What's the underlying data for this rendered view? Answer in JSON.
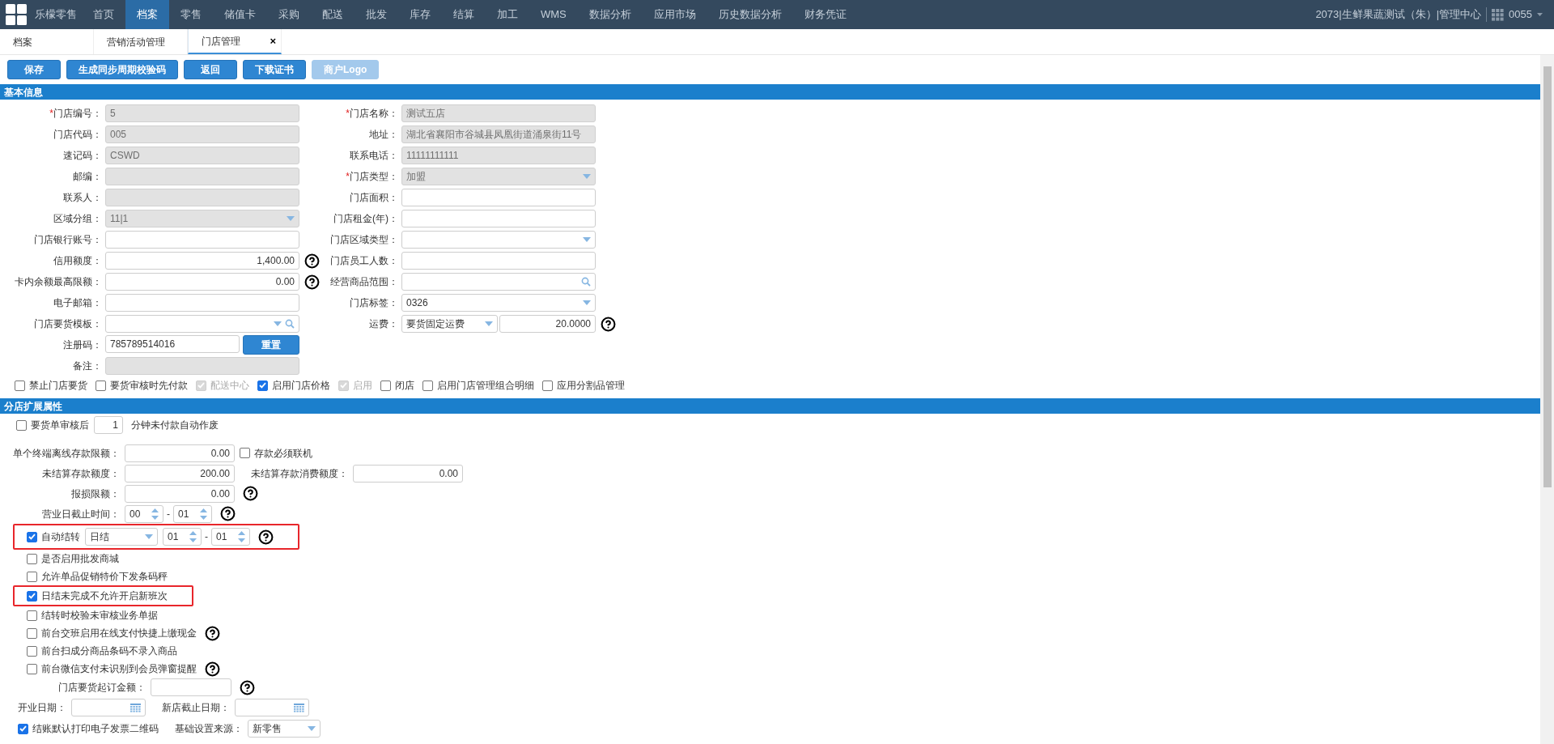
{
  "nav": {
    "brand": "乐檬零售",
    "items": [
      {
        "label": "首页",
        "selected": false
      },
      {
        "label": "档案",
        "selected": true
      },
      {
        "label": "零售",
        "selected": false
      },
      {
        "label": "储值卡",
        "selected": false
      },
      {
        "label": "采购",
        "selected": false
      },
      {
        "label": "配送",
        "selected": false
      },
      {
        "label": "批发",
        "selected": false
      },
      {
        "label": "库存",
        "selected": false
      },
      {
        "label": "结算",
        "selected": false
      },
      {
        "label": "加工",
        "selected": false
      },
      {
        "label": "WMS",
        "selected": false
      },
      {
        "label": "数据分析",
        "selected": false
      },
      {
        "label": "应用市场",
        "selected": false
      },
      {
        "label": "历史数据分析",
        "selected": false
      },
      {
        "label": "财务凭证",
        "selected": false
      }
    ],
    "account": "2073|生鲜果蔬测试（朱）|管理中心",
    "user": "0055"
  },
  "tabs": [
    {
      "label": "档案",
      "selected": false
    },
    {
      "label": "营销活动管理",
      "selected": false
    },
    {
      "label": "门店管理",
      "selected": true,
      "close": "×"
    }
  ],
  "toolbar": [
    {
      "label": "保存",
      "disabled": false
    },
    {
      "label": "生成同步周期校验码",
      "disabled": false
    },
    {
      "label": "返回",
      "disabled": false
    },
    {
      "label": "下载证书",
      "disabled": false
    },
    {
      "label": "商户Logo",
      "disabled": true
    }
  ],
  "basic": {
    "title": "基本信息",
    "rows": [
      {
        "left": {
          "marker": "*",
          "label": "门店编号：",
          "kind": "input",
          "value": "5",
          "disabled": true,
          "numeric": false,
          "help": false
        },
        "right": {
          "marker": "*",
          "label": "门店名称：",
          "kind": "input",
          "value": "测试五店",
          "disabled": true,
          "numeric": false,
          "help": false
        }
      },
      {
        "left": {
          "label": "门店代码：",
          "kind": "input",
          "value": "005",
          "disabled": true,
          "numeric": false,
          "help": false
        },
        "right": {
          "label": "地址：",
          "kind": "input",
          "value": "湖北省襄阳市谷城县凤凰街道涌泉街11号",
          "disabled": true,
          "numeric": false,
          "help": false
        }
      },
      {
        "left": {
          "label": "速记码：",
          "kind": "input",
          "value": "CSWD",
          "disabled": true,
          "numeric": false,
          "help": false
        },
        "right": {
          "label": "联系电话：",
          "kind": "input",
          "value": "11111111111",
          "disabled": true,
          "numeric": false,
          "help": false
        }
      },
      {
        "left": {
          "label": "邮编：",
          "kind": "input",
          "disabled": true,
          "help": false
        },
        "right": {
          "marker": "*",
          "label": "门店类型：",
          "kind": "select",
          "value": "加盟",
          "disabled": true,
          "help": false
        }
      },
      {
        "left": {
          "label": "联系人：",
          "kind": "input",
          "disabled": true,
          "help": false
        },
        "right": {
          "label": "门店面积：",
          "kind": "input",
          "disabled": false,
          "help": false
        }
      },
      {
        "left": {
          "label": "区域分组：",
          "kind": "select",
          "value": "11|1",
          "disabled": true,
          "help": false
        },
        "right": {
          "label": "门店租金(年)：",
          "kind": "input",
          "disabled": false,
          "help": false
        }
      },
      {
        "left": {
          "label": "门店银行账号：",
          "kind": "input",
          "disabled": false,
          "help": false
        },
        "right": {
          "label": "门店区域类型：",
          "kind": "select",
          "disabled": false,
          "help": false
        }
      },
      {
        "left": {
          "label": "信用额度：",
          "kind": "input",
          "value": "1,400.00",
          "disabled": false,
          "numeric": true,
          "help": true
        },
        "right": {
          "label": "门店员工人数：",
          "kind": "input",
          "disabled": false,
          "help": false
        }
      },
      {
        "left": {
          "label": "卡内余额最高限额：",
          "kind": "input",
          "value": "0.00",
          "disabled": false,
          "numeric": true,
          "help": true
        },
        "right": {
          "label": "经营商品范围：",
          "kind": "search",
          "disabled": false,
          "help": false
        }
      },
      {
        "left": {
          "label": "电子邮箱：",
          "kind": "input",
          "disabled": false,
          "help": false
        },
        "right": {
          "label": "门店标签：",
          "kind": "select",
          "value": "0326",
          "disabled": false,
          "help": false
        }
      },
      {
        "left": {
          "label": "门店要货模板：",
          "kind": "select_search",
          "disabled": false,
          "help": false
        },
        "right": {
          "label": "运费：",
          "kind": "select_input",
          "value": "要货固定运费",
          "value2": "20.0000",
          "disabled": false,
          "help": true
        }
      },
      {
        "left": {
          "label": "注册码：",
          "kind": "input_button",
          "value": "785789514016",
          "button": "重置",
          "disabled": false,
          "help": false
        }
      },
      {
        "left": {
          "label": "备注：",
          "kind": "input",
          "disabled": true,
          "help": false
        }
      }
    ],
    "checkboxes": [
      {
        "label": "禁止门店要货",
        "checked": false,
        "disabled": false
      },
      {
        "label": "要货审核时先付款",
        "checked": false,
        "disabled": false
      },
      {
        "label": "配送中心",
        "checked": true,
        "disabled": true
      },
      {
        "label": "启用门店价格",
        "checked": true,
        "disabled": false
      },
      {
        "label": "启用",
        "checked": true,
        "disabled": true
      },
      {
        "label": "闭店",
        "checked": false,
        "disabled": false
      },
      {
        "label": "启用门店管理组合明细",
        "checked": false,
        "disabled": false
      },
      {
        "label": "应用分割品管理",
        "checked": false,
        "disabled": false
      }
    ]
  },
  "extended": {
    "title": "分店扩展属性",
    "rows": [
      {
        "kind": "inline",
        "highlighted": false,
        "items": [
          {
            "kind": "checkbox",
            "label": "要货单审核后",
            "checked": false
          },
          {
            "kind": "count",
            "value": "1"
          },
          {
            "kind": "text",
            "text": "分钟未付款自动作废"
          }
        ]
      },
      {
        "kind": "form",
        "highlighted": false,
        "items": [
          {
            "kind": "label",
            "text": "单个终端离线存款限额："
          },
          {
            "kind": "input",
            "value": "0.00"
          },
          {
            "kind": "checkbox",
            "label": "存款必须联机",
            "checked": false
          }
        ]
      },
      {
        "kind": "form",
        "highlighted": false,
        "items": [
          {
            "kind": "label",
            "text": "未结算存款额度："
          },
          {
            "kind": "input",
            "value": "200.00"
          },
          {
            "kind": "label",
            "text": "未结算存款消费额度："
          },
          {
            "kind": "input",
            "value": "0.00"
          }
        ]
      },
      {
        "kind": "form",
        "highlighted": false,
        "items": [
          {
            "kind": "label",
            "text": "报损限额："
          },
          {
            "kind": "input",
            "value": "0.00"
          },
          {
            "kind": "help"
          }
        ]
      },
      {
        "kind": "form",
        "highlighted": false,
        "items": [
          {
            "kind": "label",
            "text": "营业日截止时间："
          },
          {
            "kind": "spinner",
            "value": "00"
          },
          {
            "kind": "dash",
            "text": "-"
          },
          {
            "kind": "spinner",
            "value": "01"
          },
          {
            "kind": "help"
          }
        ]
      },
      {
        "kind": "check",
        "highlighted": true,
        "items": [
          {
            "kind": "checkbox",
            "label": "自动结转",
            "checked": true
          },
          {
            "kind": "select",
            "value": "日结"
          },
          {
            "kind": "spinner",
            "value": "01"
          },
          {
            "kind": "dash",
            "text": "-"
          },
          {
            "kind": "spinner",
            "value": "01"
          },
          {
            "kind": "help"
          }
        ]
      },
      {
        "kind": "check",
        "highlighted": false,
        "items": [
          {
            "kind": "checkbox",
            "label": "是否启用批发商城",
            "checked": false
          }
        ]
      },
      {
        "kind": "check",
        "highlighted": false,
        "items": [
          {
            "kind": "checkbox",
            "label": "允许单品促销特价下发条码秤",
            "checked": false
          }
        ]
      },
      {
        "kind": "check",
        "highlighted": true,
        "items": [
          {
            "kind": "checkbox",
            "label": "日结未完成不允许开启新班次",
            "checked": true
          }
        ]
      },
      {
        "kind": "check",
        "highlighted": false,
        "items": [
          {
            "kind": "checkbox",
            "label": "结转时校验未审核业务单据",
            "checked": false
          }
        ]
      },
      {
        "kind": "check",
        "highlighted": false,
        "items": [
          {
            "kind": "checkbox",
            "label": "前台交班启用在线支付快捷上缴现金",
            "checked": false
          },
          {
            "kind": "help"
          }
        ]
      },
      {
        "kind": "check",
        "highlighted": false,
        "items": [
          {
            "kind": "checkbox",
            "label": "前台扫成分商品条码不录入商品",
            "checked": false
          }
        ]
      },
      {
        "kind": "check",
        "highlighted": false,
        "items": [
          {
            "kind": "checkbox",
            "label": "前台微信支付未识别到会员弹窗提醒",
            "checked": false
          },
          {
            "kind": "help"
          }
        ]
      },
      {
        "kind": "wide",
        "highlighted": false,
        "items": [
          {
            "kind": "label",
            "text": "门店要货起订金额："
          },
          {
            "kind": "amount"
          },
          {
            "kind": "help"
          }
        ]
      },
      {
        "kind": "dates",
        "highlighted": false,
        "items": [
          {
            "kind": "label",
            "text": "开业日期："
          },
          {
            "kind": "date"
          },
          {
            "kind": "label",
            "text": "新店截止日期："
          },
          {
            "kind": "date"
          }
        ]
      },
      {
        "kind": "dates",
        "highlighted": false,
        "items": [
          {
            "kind": "checkbox",
            "label": "结账默认打印电子发票二维码",
            "checked": true
          },
          {
            "kind": "label",
            "text": "基础设置来源："
          },
          {
            "kind": "select",
            "value": "新零售"
          }
        ]
      }
    ]
  }
}
